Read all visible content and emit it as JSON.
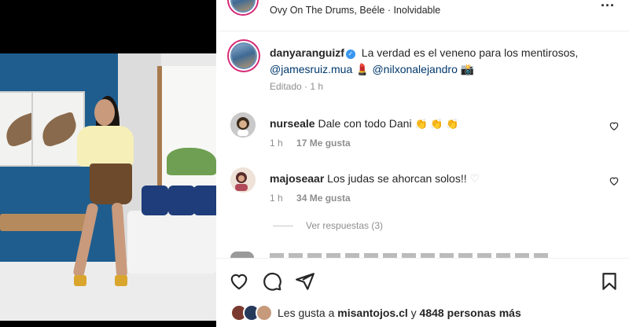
{
  "header": {
    "audio_label": "Ovy On The Drums, Beéle · Inolvidable",
    "more_label": "..."
  },
  "caption": {
    "username": "danyaranguizf",
    "text": "La verdad es el veneno para los mentirosos,",
    "mention_1": "@jamesruiz.mua",
    "emoji_1": "💄",
    "mention_2": "@nilxonalejandro",
    "emoji_2": "📸",
    "meta": "Editado · 1 h"
  },
  "comments": [
    {
      "username": "nurseale",
      "text": "Dale con todo Dani",
      "emoji": "👏 👏 👏",
      "time": "1 h",
      "likes": "17 Me gusta"
    },
    {
      "username": "majoseaar",
      "text": "Los judas se ahorcan solos!!",
      "emoji": "♡",
      "time": "1 h",
      "likes": "34 Me gusta"
    }
  ],
  "view_replies": "Ver respuestas (3)",
  "likes_summary": {
    "prefix": "Les gusta a",
    "user": "misantojos.cl",
    "connector": "y",
    "count": "4848 personas más"
  },
  "icons": {
    "like": "heart-icon",
    "comment": "comment-icon",
    "share": "share-icon",
    "save": "bookmark-icon"
  },
  "colors": {
    "mention": "#00376b",
    "meta_gray": "#8e8e8e",
    "verified_blue": "#3897f0",
    "story_ring": "#d62976"
  }
}
